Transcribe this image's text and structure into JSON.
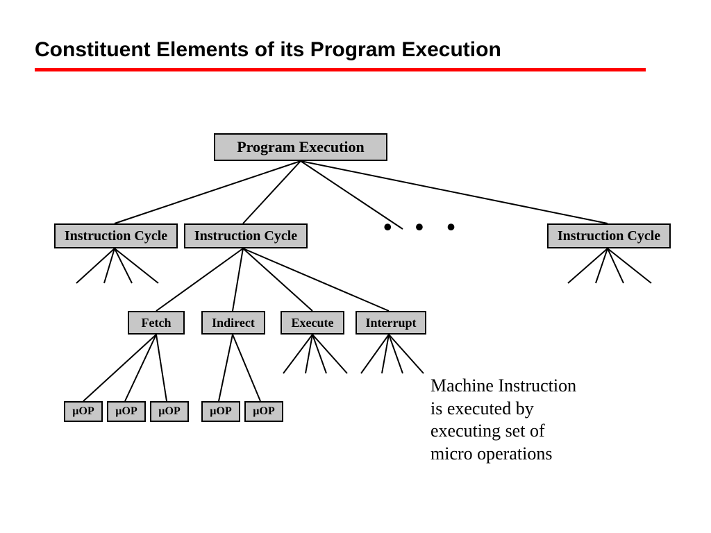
{
  "title": "Constituent Elements of its Program Execution",
  "colors": {
    "underline": "#fe0000",
    "node_bg": "#c7c7c7"
  },
  "nodes": {
    "root": "Program Execution",
    "ic1": "Instruction Cycle",
    "ic2": "Instruction Cycle",
    "ic3": "Instruction Cycle",
    "fetch": "Fetch",
    "indirect": "Indirect",
    "execute": "Execute",
    "interrupt": "Interrupt",
    "uop1": "µOP",
    "uop2": "µOP",
    "uop3": "µOP",
    "uop4": "µOP",
    "uop5": "µOP"
  },
  "ellipsis": "• • •",
  "caption": {
    "l1": "Machine Instruction",
    "l2": "is executed by",
    "l3": "executing set of",
    "l4": "micro operations"
  }
}
